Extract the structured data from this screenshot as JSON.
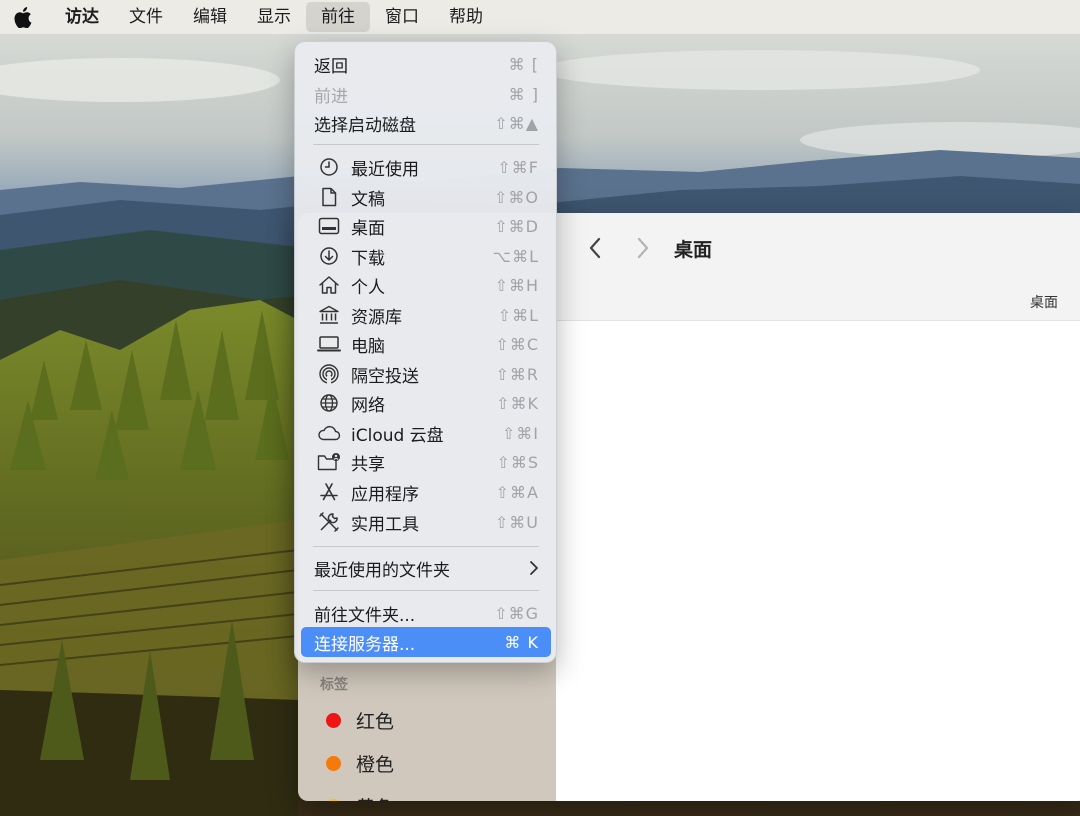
{
  "menubar": {
    "apple_icon": "apple-logo",
    "items": [
      {
        "label": "访达"
      },
      {
        "label": "文件"
      },
      {
        "label": "编辑"
      },
      {
        "label": "显示"
      },
      {
        "label": "前往"
      },
      {
        "label": "窗口"
      },
      {
        "label": "帮助"
      }
    ]
  },
  "go_menu": {
    "top_items": [
      {
        "label": "返回",
        "shortcut": "⌘ [",
        "enabled": true
      },
      {
        "label": "前进",
        "shortcut": "⌘ ]",
        "enabled": false
      },
      {
        "label": "选择启动磁盘",
        "shortcut": "⇧⌘▲",
        "enabled": true
      }
    ],
    "location_items": [
      {
        "label": "最近使用",
        "shortcut": "⇧⌘F",
        "icon": "clock-icon"
      },
      {
        "label": "文稿",
        "shortcut": "⇧⌘O",
        "icon": "document-icon"
      },
      {
        "label": "桌面",
        "shortcut": "⇧⌘D",
        "icon": "desktop-icon"
      },
      {
        "label": "下载",
        "shortcut": "⌥⌘L",
        "icon": "download-icon"
      },
      {
        "label": "个人",
        "shortcut": "⇧⌘H",
        "icon": "home-icon"
      },
      {
        "label": "资源库",
        "shortcut": "⇧⌘L",
        "icon": "library-icon"
      },
      {
        "label": "电脑",
        "shortcut": "⇧⌘C",
        "icon": "computer-icon"
      },
      {
        "label": "隔空投送",
        "shortcut": "⇧⌘R",
        "icon": "airdrop-icon"
      },
      {
        "label": "网络",
        "shortcut": "⇧⌘K",
        "icon": "network-icon"
      },
      {
        "label": "iCloud 云盘",
        "shortcut": "⇧⌘I",
        "icon": "icloud-icon"
      },
      {
        "label": "共享",
        "shortcut": "⇧⌘S",
        "icon": "shared-folder-icon"
      },
      {
        "label": "应用程序",
        "shortcut": "⇧⌘A",
        "icon": "applications-icon"
      },
      {
        "label": "实用工具",
        "shortcut": "⇧⌘U",
        "icon": "utilities-icon"
      }
    ],
    "recent_folders": {
      "label": "最近使用的文件夹"
    },
    "bottom_items": [
      {
        "label": "前往文件夹...",
        "shortcut": "⇧⌘G",
        "selected": false
      },
      {
        "label": "连接服务器...",
        "shortcut": "⌘ K",
        "selected": true
      }
    ]
  },
  "finder": {
    "title": "桌面",
    "path_label": "桌面",
    "sidebar": {
      "tags_header": "标签",
      "tags": [
        {
          "label": "红色",
          "color": "#f01414"
        },
        {
          "label": "橙色",
          "color": "#f57a0c"
        },
        {
          "label": "黄色",
          "color": "#f5c018"
        }
      ]
    }
  },
  "colors": {
    "menu_highlight": "#4c8ef7",
    "menu_background": "#e8eaee",
    "shortcut_gray": "#a2a3a8"
  }
}
